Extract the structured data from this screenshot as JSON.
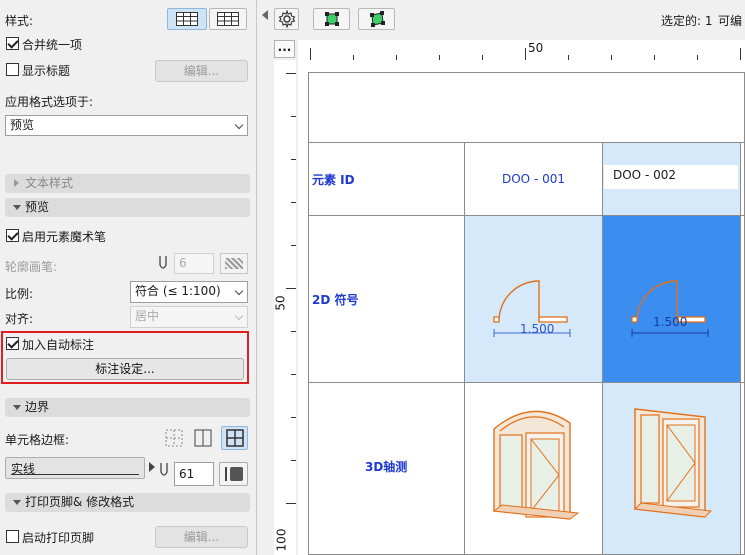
{
  "left_panel": {
    "style_label": "样式:",
    "merge_label": "合并统一项",
    "show_title_label": "显示标题",
    "edit_btn_1": "编辑...",
    "apply_format_label": "应用格式选项于:",
    "apply_format_value": "预览",
    "text_style_section": "文本样式",
    "preview_section": "预览",
    "enable_wand_label": "启用元素魔术笔",
    "outline_pen_label": "轮廓画笔:",
    "outline_pen_value": "6",
    "scale_label": "比例:",
    "scale_value": "符合 (≤ 1:100)",
    "align_label": "对齐:",
    "align_value": "居中",
    "auto_dim_label": "加入自动标注",
    "dim_settings_btn": "标注设定...",
    "border_section": "边界",
    "cell_border_label": "单元格边框:",
    "line_type_value": "实线",
    "border_pen_value": "61",
    "print_header_section": "打印页脚& 修改格式",
    "enable_footer_label": "启动打印页脚",
    "edit_btn_2": "编辑...",
    "highlight_color": "#e02020"
  },
  "toolbar": {
    "selected_text": "选定的: 1",
    "available_text": "可编",
    "ruler_corner": "..."
  },
  "ruler": {
    "top_50": "50",
    "left_50": "50",
    "left_100": "100"
  },
  "table": {
    "row_element_id": "元素 ID",
    "row_2d": "2D 符号",
    "row_3d": "3D轴测",
    "id_1": "DOO - 001",
    "id_2": "DOO - 002",
    "dim_1": "1.500",
    "dim_2": "1.500",
    "selected_color": "#3b8ef0",
    "light_color": "#d6e9fb"
  }
}
